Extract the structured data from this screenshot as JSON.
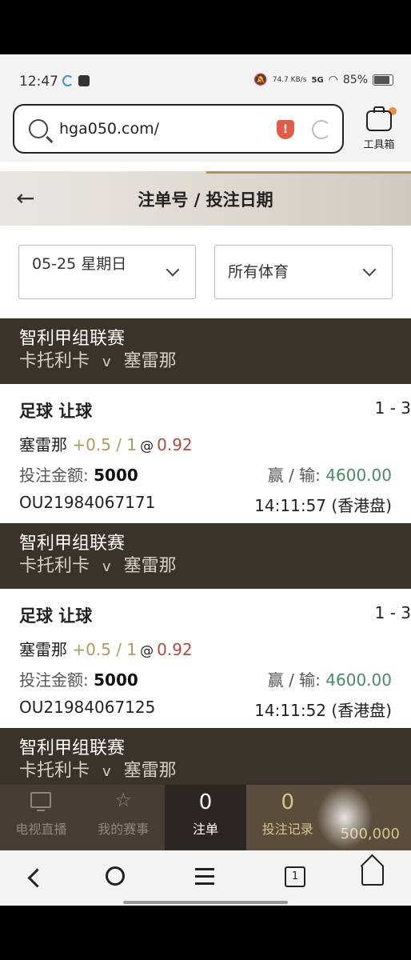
{
  "status": {
    "time": "12:47",
    "net_speed": "74.7 KB/s",
    "network": "5G",
    "battery": "85%"
  },
  "browser": {
    "url": "hga050.com/",
    "toolbox_label": "工具箱"
  },
  "header": {
    "title": "注单号 / 投注日期"
  },
  "filters": {
    "date": "05-25 星期日",
    "sport": "所有体育"
  },
  "bets": [
    {
      "league": "智利甲组联赛",
      "home": "卡托利卡",
      "vs": "v",
      "away": "塞雷那",
      "sport": "足球 让球",
      "score": "1 - 3",
      "team": "塞雷那",
      "line": "+0.5 / 1",
      "at": "@",
      "odds": "0.92",
      "stake_label": "投注金额:",
      "stake": "5000",
      "win_label": "赢 / 输:",
      "win": "4600.00",
      "ticket": "OU21984067171",
      "time": "14:11:57 (香港盘)"
    },
    {
      "league": "智利甲组联赛",
      "home": "卡托利卡",
      "vs": "v",
      "away": "塞雷那",
      "sport": "足球 让球",
      "score": "1 - 3",
      "team": "塞雷那",
      "line": "+0.5 / 1",
      "at": "@",
      "odds": "0.92",
      "stake_label": "投注金额:",
      "stake": "5000",
      "win_label": "赢 / 输:",
      "win": "4600.00",
      "ticket": "OU21984067125",
      "time": "14:11:52 (香港盘)"
    },
    {
      "league": "智利甲组联赛",
      "home": "卡托利卡",
      "vs": "v",
      "away": "塞雷那"
    }
  ],
  "tabs": [
    {
      "label": "电视直播",
      "icon": "tv-icon"
    },
    {
      "label": "我的赛事",
      "icon": "star-icon"
    },
    {
      "label": "注单",
      "count": "0"
    },
    {
      "label": "投注记录",
      "count": "0"
    }
  ],
  "balance": "500,000",
  "nav": {
    "tabs_count": "1"
  }
}
